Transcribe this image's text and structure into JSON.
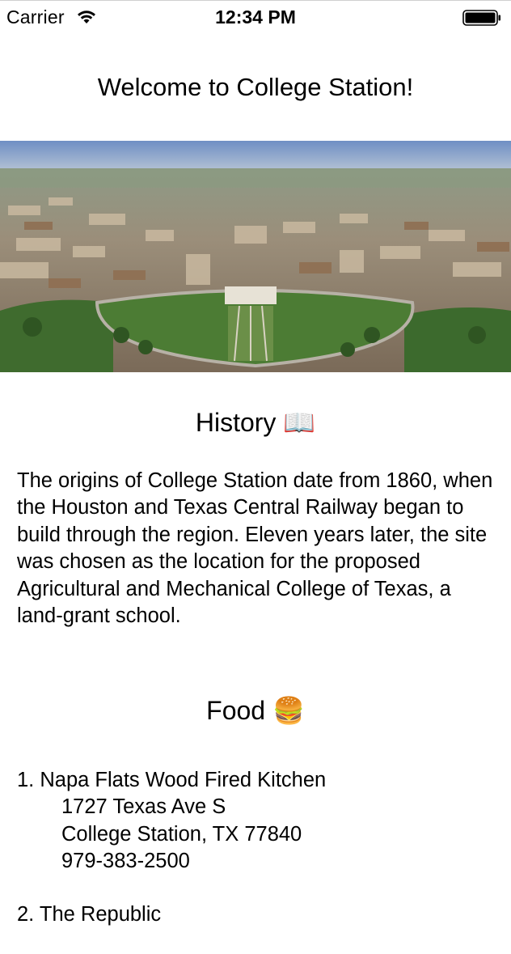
{
  "status_bar": {
    "carrier": "Carrier",
    "time": "12:34 PM",
    "wifi_icon": "wifi-icon",
    "battery_icon": "battery-icon"
  },
  "page": {
    "title": "Welcome to College Station!",
    "hero_image": "aerial-campus-photo"
  },
  "history": {
    "title": "History",
    "emoji": "📖",
    "body": "The origins of College Station date from 1860, when the Houston and Texas Central Railway began to build through the region. Eleven years later, the site was chosen as the location for the proposed Agricultural and Mechanical College of Texas, a land-grant school."
  },
  "food": {
    "title": "Food",
    "emoji": "🍔",
    "items": [
      {
        "name": "1. Napa Flats Wood Fired Kitchen",
        "address1": "1727 Texas Ave S",
        "address2": "College Station, TX 77840",
        "phone": "979-383-2500"
      },
      {
        "name": "2. The Republic"
      }
    ]
  }
}
